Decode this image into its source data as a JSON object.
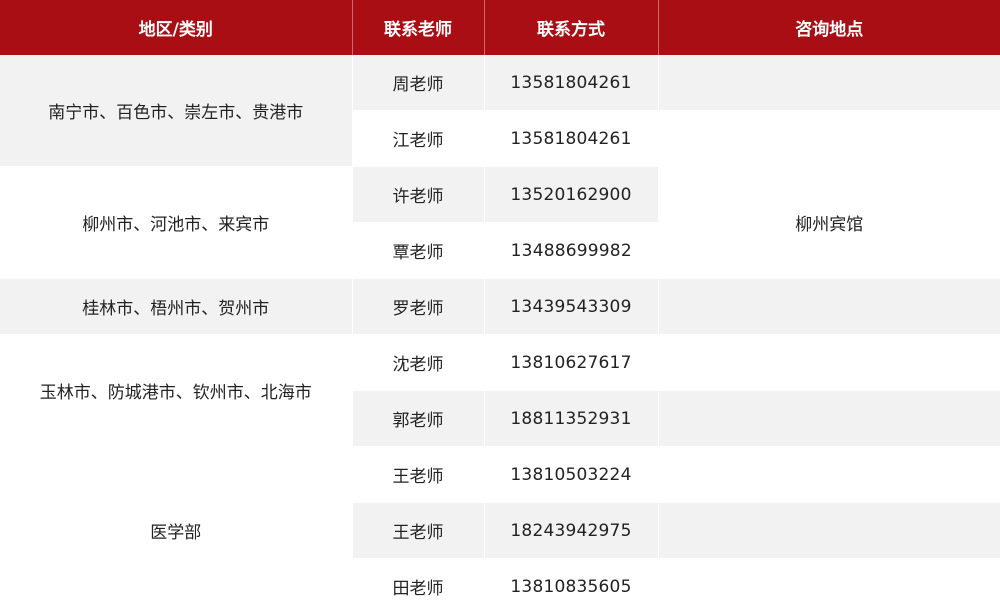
{
  "headers": {
    "region": "地区/类别",
    "teacher": "联系老师",
    "phone": "联系方式",
    "place": "咨询地点"
  },
  "groups": [
    {
      "region": "南宁市、百色市、崇左市、贵港市",
      "contacts": [
        {
          "teacher": "周老师",
          "phone": "13581804261"
        },
        {
          "teacher": "江老师",
          "phone": "13581804261"
        }
      ]
    },
    {
      "region": "柳州市、河池市、来宾市",
      "contacts": [
        {
          "teacher": "许老师",
          "phone": "13520162900"
        },
        {
          "teacher": "覃老师",
          "phone": "13488699982"
        }
      ]
    },
    {
      "region": "桂林市、梧州市、贺州市",
      "contacts": [
        {
          "teacher": "罗老师",
          "phone": "13439543309"
        }
      ]
    },
    {
      "region": "玉林市、防城港市、钦州市、北海市",
      "contacts": [
        {
          "teacher": "沈老师",
          "phone": "13810627617"
        },
        {
          "teacher": "郭老师",
          "phone": "18811352931"
        }
      ]
    },
    {
      "region": "医学部",
      "contacts": [
        {
          "teacher": "王老师",
          "phone": "13810503224"
        },
        {
          "teacher": "王老师",
          "phone": "18243942975"
        },
        {
          "teacher": "田老师",
          "phone": "13810835605"
        }
      ]
    }
  ],
  "place": "柳州宾馆",
  "colors": {
    "header_bg": "#a90e14",
    "header_text": "#ffffff",
    "row_gray": "#f2f2f2",
    "row_white": "#ffffff"
  }
}
